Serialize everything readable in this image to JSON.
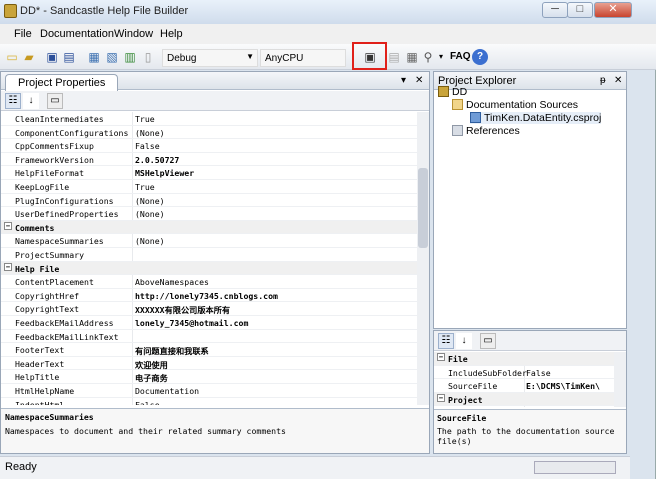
{
  "window": {
    "title": "DD* - Sandcastle Help File Builder",
    "min": "─",
    "max": "□",
    "close": "✕"
  },
  "menu": [
    "File",
    "Documentation",
    "Window",
    "Help"
  ],
  "toolbar": {
    "config": "Debug",
    "platform": "AnyCPU",
    "faq": "FAQ",
    "help": "?"
  },
  "project_properties": {
    "tab": "Project Properties",
    "pin": "▾",
    "close": "✕",
    "rows": [
      {
        "type": "prop",
        "name": "CleanIntermediates",
        "value": "True"
      },
      {
        "type": "prop",
        "name": "ComponentConfigurations",
        "value": "(None)"
      },
      {
        "type": "prop",
        "name": "CppCommentsFixup",
        "value": "False"
      },
      {
        "type": "prop",
        "name": "FrameworkVersion",
        "value": "2.0.50727",
        "bold": true
      },
      {
        "type": "prop",
        "name": "HelpFileFormat",
        "value": "MSHelpViewer",
        "bold": true
      },
      {
        "type": "prop",
        "name": "KeepLogFile",
        "value": "True"
      },
      {
        "type": "prop",
        "name": "PlugInConfigurations",
        "value": "(None)"
      },
      {
        "type": "prop",
        "name": "UserDefinedProperties",
        "value": "(None)"
      },
      {
        "type": "cat",
        "name": "Comments",
        "value": ""
      },
      {
        "type": "prop",
        "name": "NamespaceSummaries",
        "value": "(None)"
      },
      {
        "type": "prop",
        "name": "ProjectSummary",
        "value": ""
      },
      {
        "type": "cat",
        "name": "Help File",
        "value": ""
      },
      {
        "type": "prop",
        "name": "ContentPlacement",
        "value": "AboveNamespaces"
      },
      {
        "type": "prop",
        "name": "CopyrightHref",
        "value": "http://lonely7345.cnblogs.com",
        "bold": true
      },
      {
        "type": "prop",
        "name": "CopyrightText",
        "value": "XXXXXX有限公司版本所有",
        "bold": true
      },
      {
        "type": "prop",
        "name": "FeedbackEMailAddress",
        "value": "lonely_7345@hotmail.com",
        "bold": true
      },
      {
        "type": "prop",
        "name": "FeedbackEMailLinkText",
        "value": ""
      },
      {
        "type": "prop",
        "name": "FooterText",
        "value": "有问题直接和我联系",
        "bold": true
      },
      {
        "type": "prop",
        "name": "HeaderText",
        "value": "欢迎使用",
        "bold": true
      },
      {
        "type": "prop",
        "name": "HelpTitle",
        "value": "电子商务",
        "bold": true
      },
      {
        "type": "prop",
        "name": "HtmlHelpName",
        "value": "Documentation"
      },
      {
        "type": "prop",
        "name": "IndentHtml",
        "value": "False"
      }
    ],
    "desc_title": "NamespaceSummaries",
    "desc_text": "Namespaces to document and their related summary comments"
  },
  "project_explorer": {
    "title": "Project Explorer",
    "pin": "ᵽ",
    "close": "✕",
    "tree": [
      {
        "label": "DD",
        "level": 0
      },
      {
        "label": "Documentation Sources",
        "level": 1
      },
      {
        "label": "TimKen.DataEntity.csproj",
        "level": 2
      },
      {
        "label": "References",
        "level": 1
      }
    ]
  },
  "file_props": {
    "rows": [
      {
        "type": "cat",
        "name": "File",
        "value": ""
      },
      {
        "type": "prop",
        "name": "IncludeSubFolder",
        "value": "False"
      },
      {
        "type": "prop",
        "name": "SourceFile",
        "value": "E:\\DCMS\\TimKen\\",
        "bold": true
      },
      {
        "type": "cat",
        "name": "Project",
        "value": ""
      }
    ],
    "desc_title": "SourceFile",
    "desc_text": "The path to the documentation source file(s)"
  },
  "status": {
    "text": "Ready"
  },
  "colors": {
    "highlight": "#e0201a",
    "panel_bg": "#dbe4ee"
  }
}
